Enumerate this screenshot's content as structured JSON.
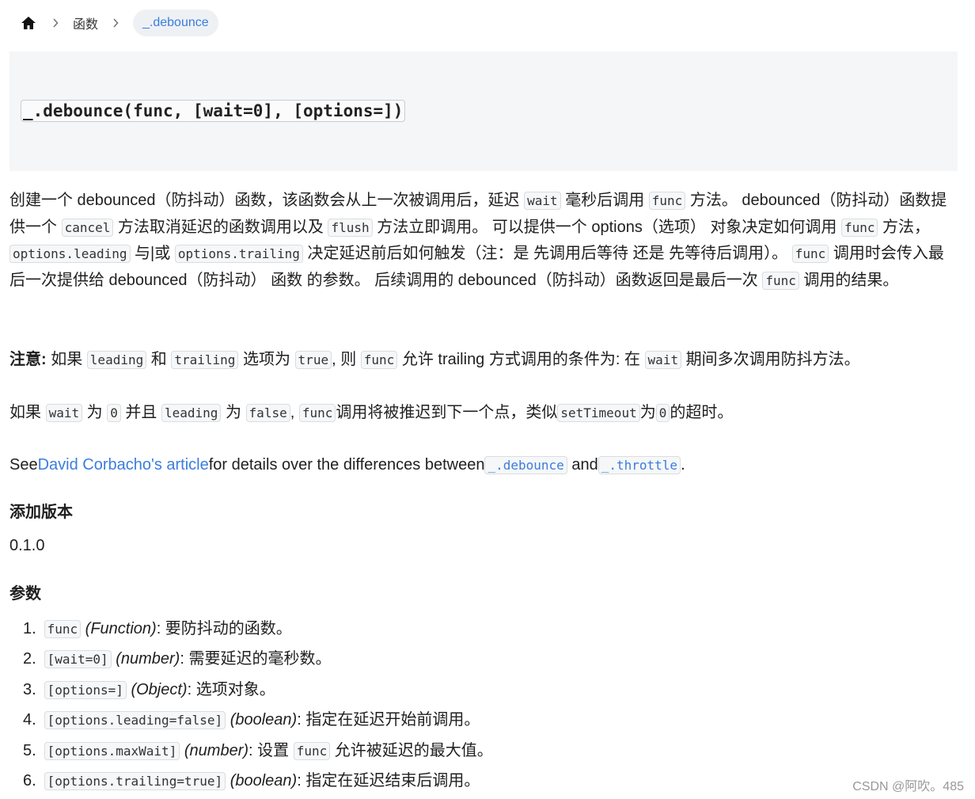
{
  "breadcrumb": {
    "home_icon": "home-icon",
    "separator_icon": "chevron-right-icon",
    "items": [
      "函数",
      "_.debounce"
    ]
  },
  "signature": "_.debounce(func, [wait=0], [options=])",
  "description": {
    "t1": "创建一个 debounced（防抖动）函数，该函数会从上一次被调用后，延迟 ",
    "c1": "wait",
    "t2": " 毫秒后调用 ",
    "c2": "func",
    "t3": " 方法。 debounced（防抖动）函数提供一个 ",
    "c3": "cancel",
    "t4": " 方法取消延迟的函数调用以及 ",
    "c4": "flush",
    "t5": " 方法立即调用。 可以提供一个 options（选项） 对象决定如何调用 ",
    "c5": "func",
    "t6": " 方法， ",
    "c6": "options.leading",
    "t7": " 与|或 ",
    "c7": "options.trailing",
    "t8": " 决定延迟前后如何触发（注：是 先调用后等待 还是 先等待后调用）。 ",
    "c8": "func",
    "t9": " 调用时会传入最后一次提供给 debounced（防抖动） 函数 的参数。 后续调用的 debounced（防抖动）函数返回是最后一次 ",
    "c9": "func",
    "t10": " 调用的结果。"
  },
  "note": {
    "label": "注意:",
    "t1": " 如果 ",
    "c1": "leading",
    "t2": " 和 ",
    "c2": "trailing",
    "t3": " 选项为 ",
    "c3": "true",
    "t4": ", 则 ",
    "c4": "func",
    "t5": " 允许 trailing 方式调用的条件为: 在 ",
    "c5": "wait",
    "t6": " 期间多次调用防抖方法。"
  },
  "note2": {
    "t1": "如果 ",
    "c1": "wait",
    "t2": " 为 ",
    "c2": "0",
    "t3": " 并且 ",
    "c3": "leading",
    "t4": " 为 ",
    "c4": "false",
    "t5": ", ",
    "c5": "func",
    "t6": "调用将被推迟到下一个点，类似",
    "c6": "setTimeout",
    "t7": "为",
    "c7": "0",
    "t8": "的超时。"
  },
  "see": {
    "t1": "See",
    "link": "David Corbacho's article",
    "t2": "for details over the differences between",
    "c1": "_.debounce",
    "t3": " and",
    "c2": "_.throttle",
    "t4": "."
  },
  "version_heading": "添加版本",
  "version": "0.1.0",
  "params_heading": "参数",
  "params": [
    {
      "num": "1.",
      "code": "func",
      "type": "(Function)",
      "desc": ": 要防抖动的函数。"
    },
    {
      "num": "2.",
      "code": "[wait=0]",
      "type": "(number)",
      "desc": ": 需要延迟的毫秒数。"
    },
    {
      "num": "3.",
      "code": "[options=]",
      "type": "(Object)",
      "desc": ": 选项对象。"
    },
    {
      "num": "4.",
      "code": "[options.leading=false]",
      "type": "(boolean)",
      "desc": ": 指定在延迟开始前调用。"
    },
    {
      "num": "5.",
      "code": "[options.maxWait]",
      "type": "(number)",
      "desc": ": 设置 ",
      "code2": "func",
      "desc2": " 允许被延迟的最大值。"
    },
    {
      "num": "6.",
      "code": "[options.trailing=true]",
      "type": "(boolean)",
      "desc": ": 指定在延迟结束后调用。"
    }
  ],
  "watermark": "CSDN @阿吹。485"
}
